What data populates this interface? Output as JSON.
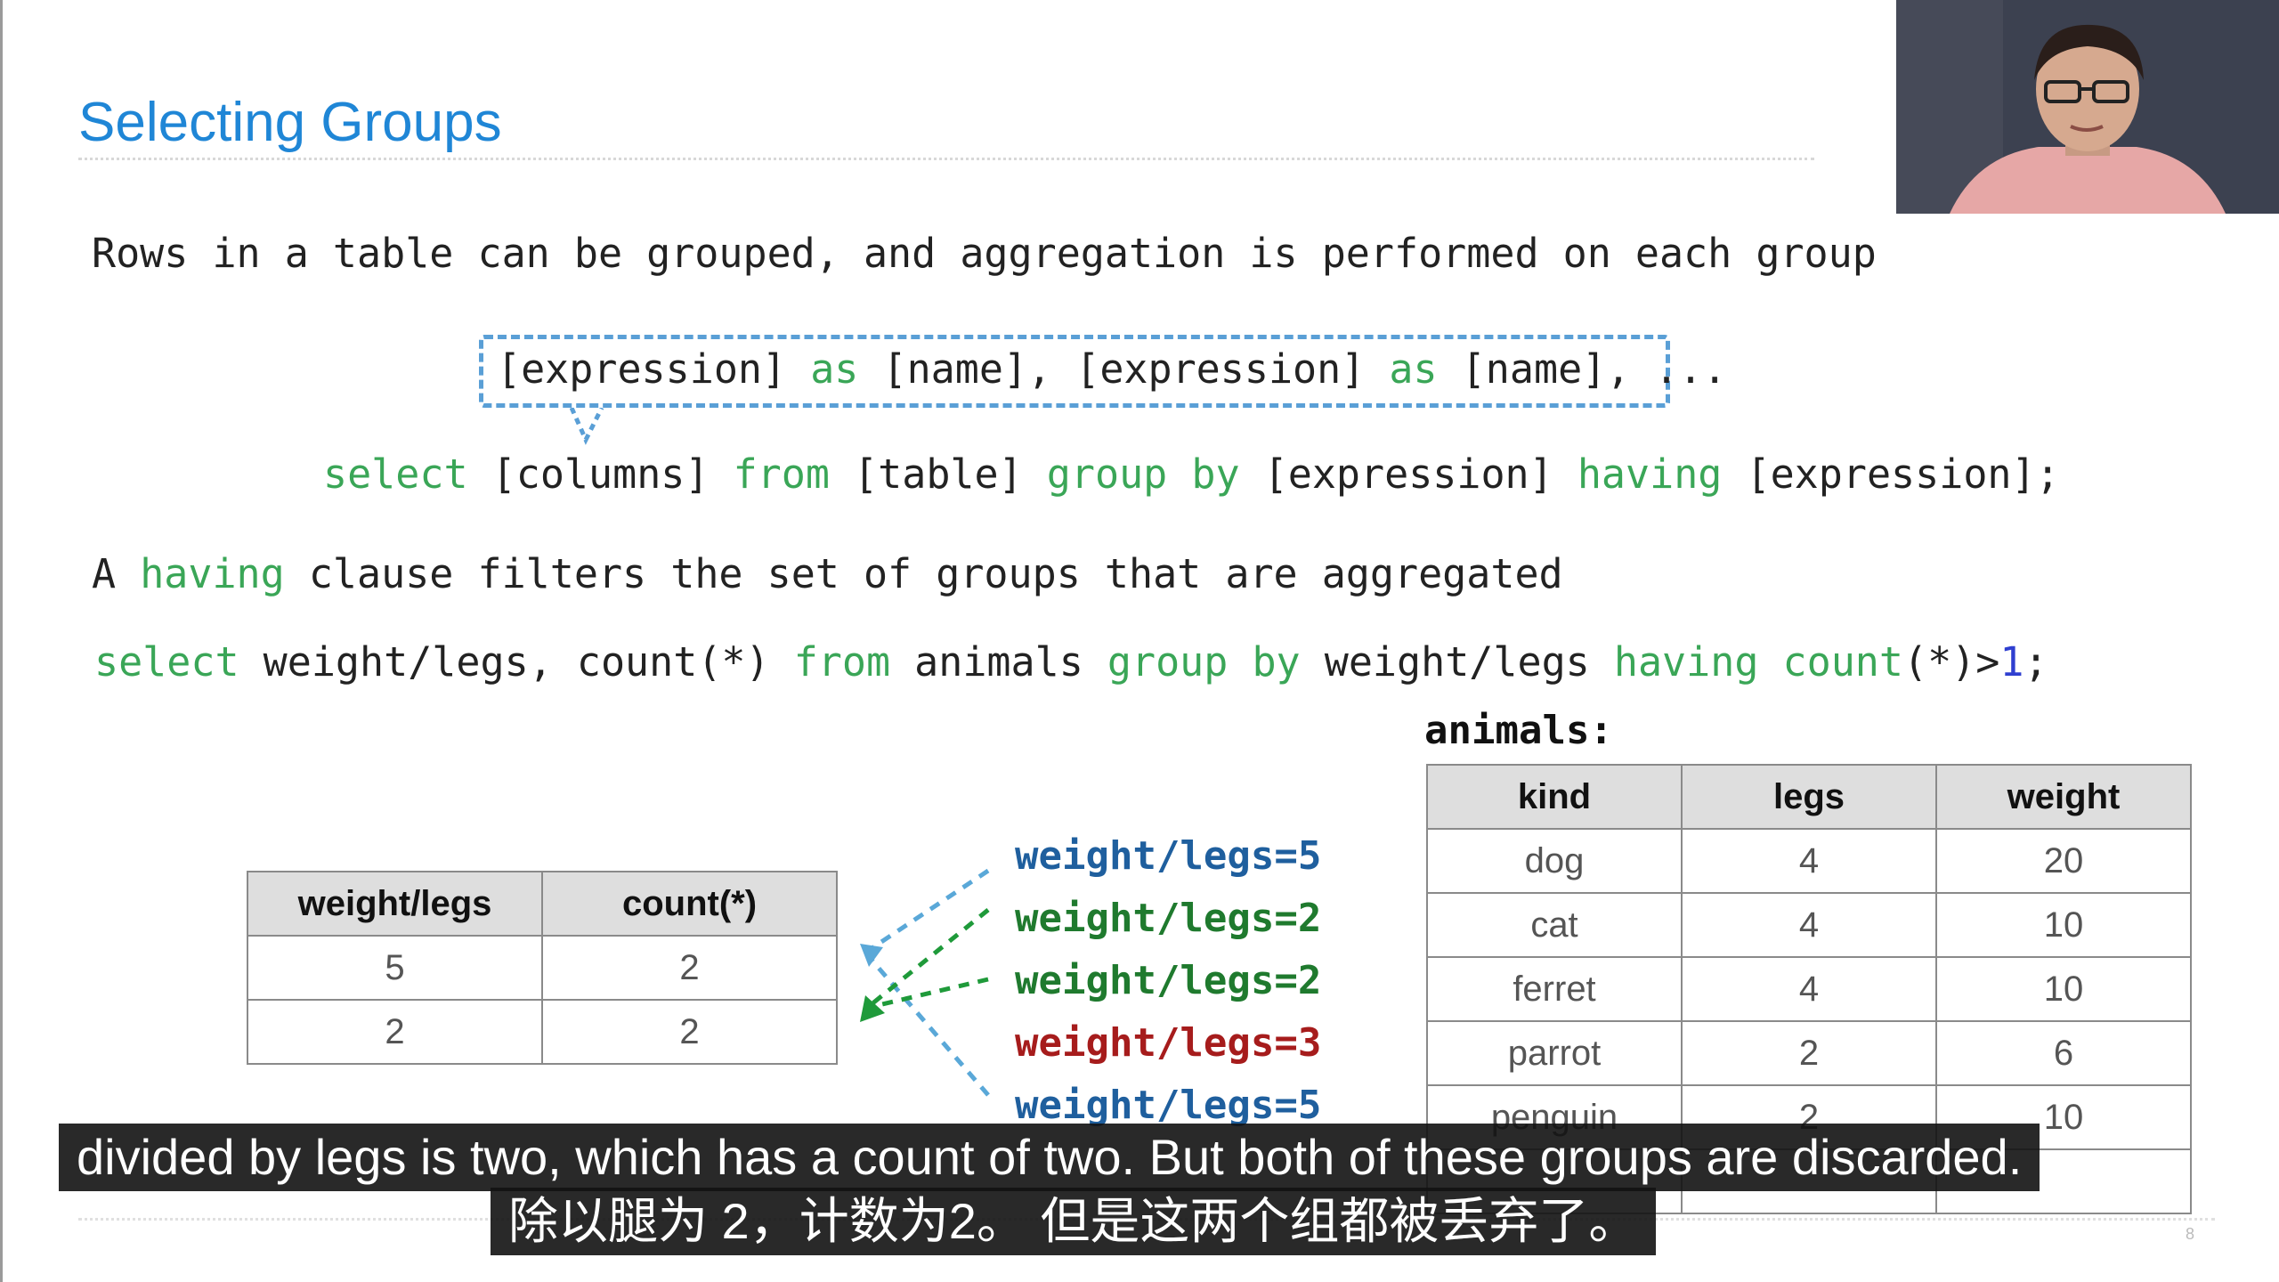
{
  "slide": {
    "title": "Selecting Groups",
    "intro": "Rows in a table can be grouped, and aggregation is performed on each group",
    "syntax_columns": {
      "p1": "[expression] ",
      "kw1": "as",
      "p2": " [name], [expression] ",
      "kw2": "as",
      "p3": " [name], ..."
    },
    "syntax_select": {
      "kw1": "select",
      "p1": " [columns] ",
      "kw2": "from",
      "p2": " [table] ",
      "kw3": "group by",
      "p3": " [expression] ",
      "kw4": "having",
      "p4": " [expression];"
    },
    "having_sentence": {
      "p1": "A ",
      "kw": "having",
      "p2": " clause filters the set of groups that are aggregated"
    },
    "example_query": {
      "kw1": "select",
      "p1": " weight/legs, count(*) ",
      "kw2": "from",
      "p2": " animals ",
      "kw3": "group by",
      "p3": " weight/legs ",
      "kw4": "having",
      "p4": " ",
      "kw5": "count",
      "p5": "(*)>",
      "num": "1",
      "p6": ";"
    },
    "result_table": {
      "headers": [
        "weight/legs",
        "count(*)"
      ],
      "rows": [
        [
          "5",
          "2"
        ],
        [
          "2",
          "2"
        ]
      ]
    },
    "groups": [
      {
        "label": "weight/legs=5",
        "color": "#1f5f9e"
      },
      {
        "label": "weight/legs=2",
        "color": "#1f7a2e"
      },
      {
        "label": "weight/legs=2",
        "color": "#1f7a2e"
      },
      {
        "label": "weight/legs=3",
        "color": "#a61c1c"
      },
      {
        "label": "weight/legs=5",
        "color": "#1f5f9e"
      }
    ],
    "animals_label": "animals:",
    "animals_table": {
      "headers": [
        "kind",
        "legs",
        "weight"
      ],
      "rows": [
        [
          "dog",
          "4",
          "20"
        ],
        [
          "cat",
          "4",
          "10"
        ],
        [
          "ferret",
          "4",
          "10"
        ],
        [
          "parrot",
          "2",
          "6"
        ],
        [
          "penguin",
          "2",
          "10"
        ]
      ]
    },
    "slide_number": "8"
  },
  "subtitles": {
    "english": "divided by legs is two, which has a count of two. But both of these groups are discarded.",
    "chinese": "除以腿为 2，计数为2。 但是这两个组都被丢弃了。"
  },
  "colors": {
    "title": "#1f86d6",
    "keyword": "#3aa657",
    "number": "#2f3fd0",
    "blue_arrow": "#5aa8d8",
    "green_arrow": "#1f9a3a"
  }
}
